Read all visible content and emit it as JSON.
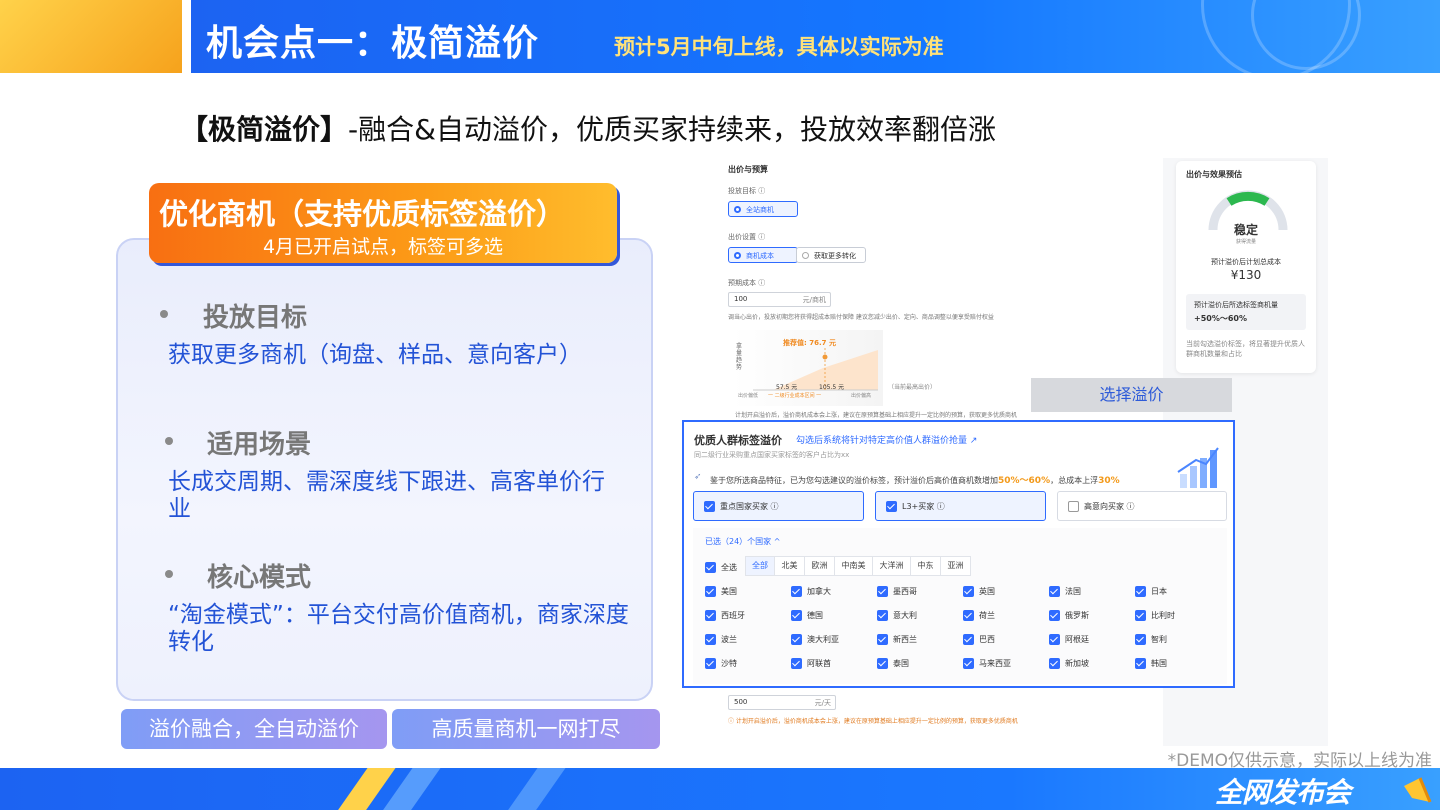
{
  "header": {
    "title": "机会点一：极简溢价",
    "note": "预计5月中旬上线，具体以实际为准"
  },
  "subtitle": {
    "bold": "【极简溢价】",
    "rest": "-融合&自动溢价，优质买家持续来，投放效率翻倍涨"
  },
  "card": {
    "tab_title": "优化商机（支持优质标签溢价）",
    "tab_sub": "4月已开启试点，标签可多选",
    "sections": [
      {
        "heading": "投放目标",
        "body": "获取更多商机（询盘、样品、意向客户）"
      },
      {
        "heading": "适用场景",
        "body": "长成交周期、需深度线下跟进、高客单价行业"
      },
      {
        "heading": "核心模式",
        "body": "“淘金模式”：平台交付高价值商机，商家深度转化"
      }
    ]
  },
  "pills": [
    "溢价融合，全自动溢价",
    "高质量商机一网打尽"
  ],
  "shot": {
    "section_title": "出价与预算",
    "goal_label": "投放目标 ⓘ",
    "goal_option": "全站商机",
    "bid_label": "出价设置 ⓘ",
    "bid_options": [
      "商机成本",
      "获取更多转化"
    ],
    "cost_label": "预期成本 ⓘ",
    "cost_value": "100",
    "cost_unit": "元/商机",
    "cost_hint": "调当心出价，投放初期您将获得超成本赔付保障  建议您减少出价、定向、商品调整以便享受赔付权益",
    "chart_recommend": "推荐值: 76.7 元",
    "chart_low": "57.5 元",
    "chart_high": "105.5 元",
    "chart_axis_left": "出价偏低",
    "chart_axis_mid": "一 二级行业成本区间 一",
    "chart_axis_right": "出价偏高",
    "chart_peer": "（当前最高出价）",
    "chart_ylabel": "拿量趋势",
    "chart_hint": "计划开启溢价后，溢价商机成本会上涨，建议在原预算基础上相应提升一定比例的预算，获取更多优质商机",
    "budget_value": "500",
    "budget_unit": "元/天",
    "budget_hint": "ⓘ 计划开启溢价后，溢价商机成本会上涨，建议在原预算基础上相应提升一定比例的预算，获取更多优质商机",
    "side": {
      "title": "出价与效果预估",
      "gauge_label": "稳定",
      "gauge_sub": "获得流量",
      "cost_label": "预计溢价后计划总成本",
      "cost_value": "¥130",
      "lift_label": "预计溢价后所选标签商机量",
      "lift_value": "+50%～60%",
      "note": "当前勾选溢价标签，将显著提升优质人群商机数量和占比"
    }
  },
  "select_button": "选择溢价",
  "popup": {
    "title": "优质人群标签溢价",
    "title_link": "勾选后系统将针对特定高价值人群溢价抢量 ↗",
    "desc": "同二级行业采购重点国家买家标签的客户占比为xx",
    "tip_prefix": "鉴于您所选商品特征，已为您勾选建议的溢价标签，预计溢价后高价值商机数增加",
    "tip_range": "50%～60%",
    "tip_mid": "，总成本上浮",
    "tip_pct": "30%",
    "tags": [
      "重点国家买家 ⓘ",
      "L3+买家 ⓘ",
      "高意向买家 ⓘ"
    ],
    "selected_label": "已选（24）个国家 ^",
    "select_all": "全选",
    "regions": [
      "全部",
      "北美",
      "欧洲",
      "中南美",
      "大洋洲",
      "中东",
      "亚洲"
    ],
    "countries": [
      [
        "美国",
        "加拿大",
        "墨西哥",
        "英国",
        "法国",
        "日本"
      ],
      [
        "西班牙",
        "德国",
        "意大利",
        "荷兰",
        "俄罗斯",
        "比利时"
      ],
      [
        "波兰",
        "澳大利亚",
        "新西兰",
        "巴西",
        "阿根廷",
        "智利"
      ],
      [
        "沙特",
        "阿联酋",
        "泰国",
        "马来西亚",
        "新加坡",
        "韩国"
      ]
    ]
  },
  "footer": {
    "demo_note": "*DEMO仅供示意，实际以上线为准",
    "logo": "全网发布会"
  },
  "colors": {
    "brand_blue": "#1c63f2",
    "accent_orange": "#fc8c14",
    "highlight_yellow": "#ffe27a",
    "link_blue": "#2353d6"
  }
}
